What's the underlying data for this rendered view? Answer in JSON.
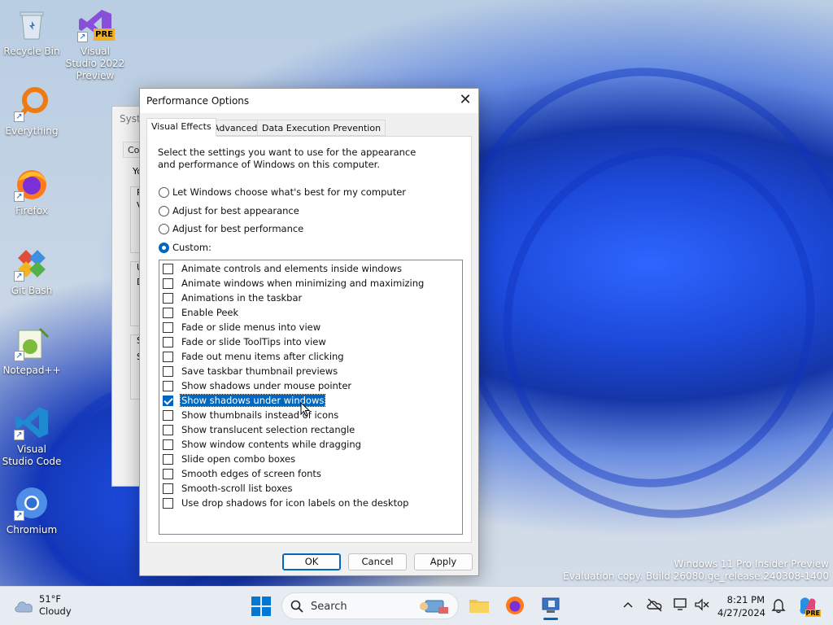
{
  "desktop": {
    "icons": [
      {
        "label": "Recycle Bin"
      },
      {
        "label": "Visual Studio 2022 Preview",
        "badge": "PRE"
      },
      {
        "label": "Everything"
      },
      {
        "label": "Firefox"
      },
      {
        "label": "Git Bash"
      },
      {
        "label": "Notepad++"
      },
      {
        "label": "Visual Studio Code"
      },
      {
        "label": "Chromium"
      }
    ],
    "watermark": {
      "line1": "Windows 11 Pro Insider Preview",
      "line2": "Evaluation copy. Build 26080.ge_release.240308-1400"
    }
  },
  "background_window": {
    "title": "Syste",
    "tab": "Com",
    "fragments": [
      "Yo",
      "P",
      "V",
      "U",
      "D",
      "S",
      "S"
    ]
  },
  "dialog": {
    "title": "Performance Options",
    "close_glyph": "✕",
    "tabs": [
      {
        "label": "Visual Effects",
        "active": true
      },
      {
        "label": "Advanced",
        "active": false
      },
      {
        "label": "Data Execution Prevention",
        "active": false
      }
    ],
    "intro": "Select the settings you want to use for the appearance and performance of Windows on this computer.",
    "radios": [
      {
        "label": "Let Windows choose what's best for my computer",
        "selected": false
      },
      {
        "label": "Adjust for best appearance",
        "selected": false
      },
      {
        "label": "Adjust for best performance",
        "selected": false
      },
      {
        "label": "Custom:",
        "selected": true
      }
    ],
    "effects": [
      {
        "label": "Animate controls and elements inside windows",
        "checked": false
      },
      {
        "label": "Animate windows when minimizing and maximizing",
        "checked": false
      },
      {
        "label": "Animations in the taskbar",
        "checked": false
      },
      {
        "label": "Enable Peek",
        "checked": false
      },
      {
        "label": "Fade or slide menus into view",
        "checked": false
      },
      {
        "label": "Fade or slide ToolTips into view",
        "checked": false
      },
      {
        "label": "Fade out menu items after clicking",
        "checked": false
      },
      {
        "label": "Save taskbar thumbnail previews",
        "checked": false
      },
      {
        "label": "Show shadows under mouse pointer",
        "checked": false
      },
      {
        "label": "Show shadows under windows",
        "checked": true,
        "selected": true
      },
      {
        "label": "Show thumbnails instead of icons",
        "checked": false
      },
      {
        "label": "Show translucent selection rectangle",
        "checked": false
      },
      {
        "label": "Show window contents while dragging",
        "checked": false
      },
      {
        "label": "Slide open combo boxes",
        "checked": false
      },
      {
        "label": "Smooth edges of screen fonts",
        "checked": false
      },
      {
        "label": "Smooth-scroll list boxes",
        "checked": false
      },
      {
        "label": "Use drop shadows for icon labels on the desktop",
        "checked": false
      }
    ],
    "buttons": {
      "ok": "OK",
      "cancel": "Cancel",
      "apply": "Apply"
    }
  },
  "taskbar": {
    "weather": {
      "temp": "51°F",
      "condition": "Cloudy"
    },
    "search_label": "Search",
    "clock": {
      "time": "8:21 PM",
      "date": "4/27/2024"
    },
    "tray_copilot_badge": "PRE"
  },
  "colors": {
    "accent": "#0067c0",
    "wallpaper_blue": "#1c49d8"
  }
}
